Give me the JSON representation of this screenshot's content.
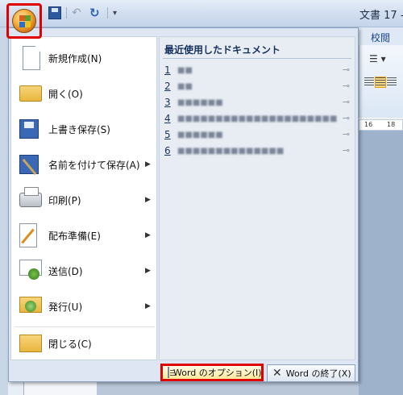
{
  "title_bar": {
    "document_title": "文書 17 -",
    "qat": {
      "undo_glyph": "↶",
      "redo_glyph": "↻",
      "customize_glyph": "▾"
    }
  },
  "ribbon": {
    "visible_tab": "校閲",
    "list_glyph": "☰ ▾",
    "ruler": {
      "mark_16": "16",
      "mark_18": "18"
    }
  },
  "office_menu": {
    "items": [
      {
        "label": "新規作成(N)",
        "icon": "new-document-icon",
        "has_submenu": false
      },
      {
        "label": "開く(O)",
        "icon": "open-folder-icon",
        "has_submenu": false
      },
      {
        "label": "上書き保存(S)",
        "icon": "save-disk-icon",
        "has_submenu": false
      },
      {
        "label": "名前を付けて保存(A)",
        "icon": "save-as-icon",
        "has_submenu": true
      },
      {
        "label": "印刷(P)",
        "icon": "printer-icon",
        "has_submenu": true
      },
      {
        "label": "配布準備(E)",
        "icon": "prepare-document-icon",
        "has_submenu": true
      },
      {
        "label": "送信(D)",
        "icon": "send-icon",
        "has_submenu": true
      },
      {
        "label": "発行(U)",
        "icon": "publish-icon",
        "has_submenu": true
      },
      {
        "label": "閉じる(C)",
        "icon": "close-folder-icon",
        "has_submenu": false
      }
    ],
    "submenu_arrow": "▶",
    "recent": {
      "heading": "最近使用したドキュメント",
      "pin_glyph": "⊸",
      "items": [
        {
          "num": "1",
          "name": "■■"
        },
        {
          "num": "2",
          "name": "■■"
        },
        {
          "num": "3",
          "name": "■■■■■■"
        },
        {
          "num": "4",
          "name": "■■■■■■■■■■■■■■■■■■■■■"
        },
        {
          "num": "5",
          "name": "■■■■■■"
        },
        {
          "num": "6",
          "name": "■■■■■■■■■■■■■■"
        }
      ]
    },
    "buttons": {
      "options": "Word のオプション(I)",
      "exit": "Word の終了(X)",
      "exit_glyph": "✕"
    }
  }
}
